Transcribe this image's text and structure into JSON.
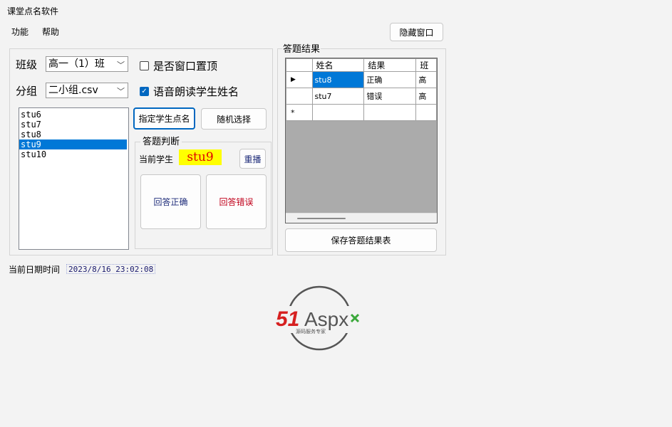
{
  "window": {
    "title": "课堂点名软件"
  },
  "menu": {
    "items": [
      "功能",
      "帮助"
    ],
    "hide_button": "隐藏窗口"
  },
  "left": {
    "class_label": "班级",
    "class_value": "高一（1）班",
    "group_label": "分组",
    "group_value": "二小组.csv",
    "topmost": {
      "label": "是否窗口置顶",
      "checked": false
    },
    "voice": {
      "label": "语音朗读学生姓名",
      "checked": true
    },
    "students": [
      "stu6",
      "stu7",
      "stu8",
      "stu9",
      "stu10"
    ],
    "selected_student": "stu9",
    "assign_button": "指定学生点名",
    "random_button": "随机选择",
    "judge_group": {
      "title": "答题判断",
      "current_label": "当前学生",
      "current_student": "stu9",
      "replay_button": "重播",
      "correct_button": "回答正确",
      "wrong_button": "回答错误",
      "correct_color": "#1f2d7a",
      "wrong_color": "#c0001a"
    }
  },
  "right": {
    "title": "答题结果",
    "columns": [
      "姓名",
      "结果",
      "班"
    ],
    "rows": [
      {
        "name": "stu8",
        "result": "正确",
        "extra": "高"
      },
      {
        "name": "stu7",
        "result": "错误",
        "extra": "高"
      }
    ],
    "new_row_marker": "*",
    "current_row_marker": "▶",
    "save_button": "保存答题结果表"
  },
  "status": {
    "date_label": "当前日期时间",
    "date_value": "2023/8/16 23:02:08"
  },
  "logo": {
    "text_51": "51",
    "text_aspx": "Aspx",
    "tagline": "源码服务专家"
  }
}
